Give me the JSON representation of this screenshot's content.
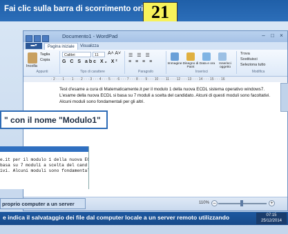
{
  "header": {
    "question": "Fai clic sulla barra di scorrimento orizzontale",
    "number": "21"
  },
  "window": {
    "title": "Documento1 - WordPad"
  },
  "tabs": {
    "file": "",
    "home": "Pagina iniziale",
    "view": "Visualizza"
  },
  "ribbon": {
    "paste": "Incolla",
    "cut": "Taglia",
    "copy": "Copia",
    "font_name": "Calibri",
    "font_size": "11",
    "image": "Immagine",
    "paint": "Disegno di Paint",
    "datetime": "Data e ora",
    "object": "Inserisci oggetto",
    "find": "Trova",
    "replace": "Sostituisci",
    "select_all": "Seleziona tutto",
    "group_clipboard": "Appunti",
    "group_font": "Tipo di carattere",
    "group_paragraph": "Paragrafo",
    "group_insert": "Inserisci",
    "group_edit": "Modifica"
  },
  "document": {
    "lines": [
      "Test d'esame a cura di Matematicamente.it per il modulo 1 della nuova ECDL sistema operativo windows7.",
      "L'esame della nuova ECDL si basa su 7 moduli a scelta del candidato. Alcuni di questi moduli sono facoltativi.",
      "Alcuni moduli sono fondamentali per gli altri."
    ]
  },
  "status": {
    "zoom": "110%"
  },
  "overlay": {
    "text": "\" con il nome \"Modulo1\""
  },
  "monospace": {
    "lines": [
      "e.it per il modulo 1 della nuova ECD",
      " basa su 7 moduli a scelta del cand",
      "ivi. Alcuni moduli sono fondamental"
    ]
  },
  "server_label": "proprio computer a un server",
  "bottom": {
    "question": "e indica il salvataggio dei file dal computer locale a un server remoto utilizzando",
    "time": "07:15",
    "date": "25/12/2014"
  },
  "colors": {
    "header_bg": "#1f5fa8",
    "number_bg": "#f7f25a"
  }
}
